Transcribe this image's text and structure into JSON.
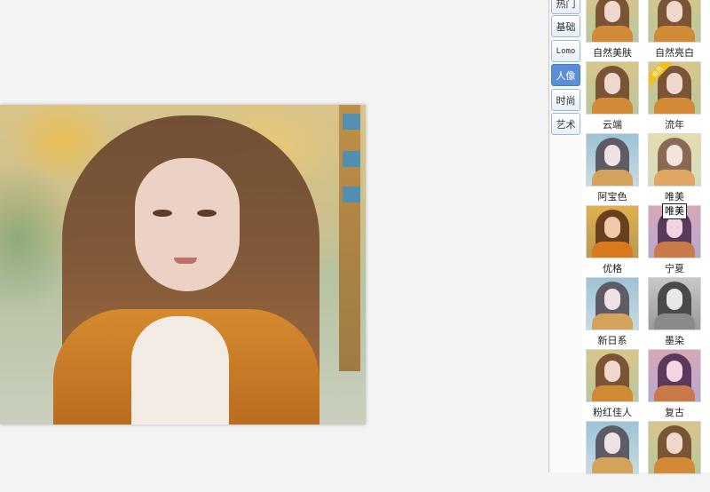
{
  "tabs": [
    {
      "label": "热门",
      "active": false
    },
    {
      "label": "基础",
      "active": false
    },
    {
      "label": "Lomo",
      "active": false
    },
    {
      "label": "人像",
      "active": true
    },
    {
      "label": "时尚",
      "active": false
    },
    {
      "label": "艺术",
      "active": false
    }
  ],
  "filters": [
    {
      "label": "自然美肤",
      "tone": "warm"
    },
    {
      "label": "自然亮白",
      "tone": "warm"
    },
    {
      "label": "云端",
      "tone": "warm"
    },
    {
      "label": "流年",
      "tone": "warm",
      "vip": "会员"
    },
    {
      "label": "阿宝色",
      "tone": "cool"
    },
    {
      "label": "唯美",
      "tone": "soft"
    },
    {
      "label": "优格",
      "tone": "orange"
    },
    {
      "label": "宁夏",
      "tone": "purple"
    },
    {
      "label": "新日系",
      "tone": "cool"
    },
    {
      "label": "墨染",
      "tone": "gray"
    },
    {
      "label": "粉红佳人",
      "tone": "warm"
    },
    {
      "label": "复古",
      "tone": "purple"
    },
    {
      "label": "",
      "tone": "cool"
    },
    {
      "label": "",
      "tone": "warm"
    }
  ],
  "tooltip": "唯美"
}
